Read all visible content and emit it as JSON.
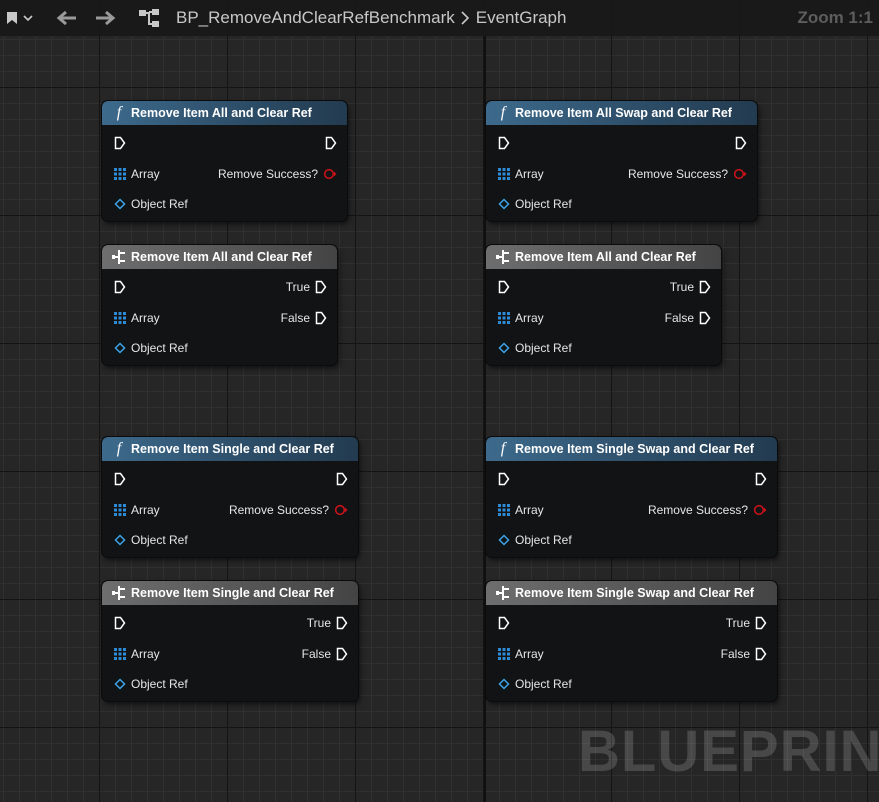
{
  "toolbar": {
    "left_icon": "bookmark-icon",
    "left_dropdown_icon": "chevron-down-icon",
    "back_icon": "arrow-left-icon",
    "forward_icon": "arrow-right-icon",
    "graph_icon": "graph-tree-icon",
    "breadcrumb_blueprint": "BP_RemoveAndClearRefBenchmark",
    "breadcrumb_separator_icon": "chevron-right-icon",
    "breadcrumb_graph": "EventGraph",
    "zoom": "Zoom 1:1"
  },
  "watermark": "BLUEPRINT",
  "colors": {
    "function_header": "#3d6a8c",
    "macro_header": "#6e6e6e",
    "array_pin": "#2f8bd6",
    "object_pin": "#3aa4e8",
    "bool_pin": "#c8121a",
    "exec_pin": "#ffffff"
  },
  "nodes": [
    {
      "kind": "function",
      "icon": "function-icon",
      "title": "Remove Item All and Clear Ref",
      "input_exec_icon": "exec-pin-icon",
      "output_exec_icon": "exec-pin-icon",
      "array_label": "Array",
      "object_label": "Object Ref",
      "output_label": "Remove Success?"
    },
    {
      "kind": "function",
      "icon": "function-icon",
      "title": "Remove Item All Swap and Clear Ref",
      "input_exec_icon": "exec-pin-icon",
      "output_exec_icon": "exec-pin-icon",
      "array_label": "Array",
      "object_label": "Object Ref",
      "output_label": "Remove Success?"
    },
    {
      "kind": "macro",
      "icon": "macro-icon",
      "title": "Remove Item All and Clear Ref",
      "input_exec_icon": "exec-pin-icon",
      "array_label": "Array",
      "object_label": "Object Ref",
      "true_label": "True",
      "false_label": "False"
    },
    {
      "kind": "macro",
      "icon": "macro-icon",
      "title": "Remove Item All and Clear Ref",
      "input_exec_icon": "exec-pin-icon",
      "array_label": "Array",
      "object_label": "Object Ref",
      "true_label": "True",
      "false_label": "False"
    },
    {
      "kind": "function",
      "icon": "function-icon",
      "title": "Remove Item Single and Clear Ref",
      "input_exec_icon": "exec-pin-icon",
      "output_exec_icon": "exec-pin-icon",
      "array_label": "Array",
      "object_label": "Object Ref",
      "output_label": "Remove Success?"
    },
    {
      "kind": "function",
      "icon": "function-icon",
      "title": "Remove Item Single Swap and Clear Ref",
      "input_exec_icon": "exec-pin-icon",
      "output_exec_icon": "exec-pin-icon",
      "array_label": "Array",
      "object_label": "Object Ref",
      "output_label": "Remove Success?"
    },
    {
      "kind": "macro",
      "icon": "macro-icon",
      "title": "Remove Item Single and Clear Ref",
      "input_exec_icon": "exec-pin-icon",
      "array_label": "Array",
      "object_label": "Object Ref",
      "true_label": "True",
      "false_label": "False"
    },
    {
      "kind": "macro",
      "icon": "macro-icon",
      "title": "Remove Item Single Swap and Clear Ref",
      "input_exec_icon": "exec-pin-icon",
      "array_label": "Array",
      "object_label": "Object Ref",
      "true_label": "True",
      "false_label": "False"
    }
  ]
}
